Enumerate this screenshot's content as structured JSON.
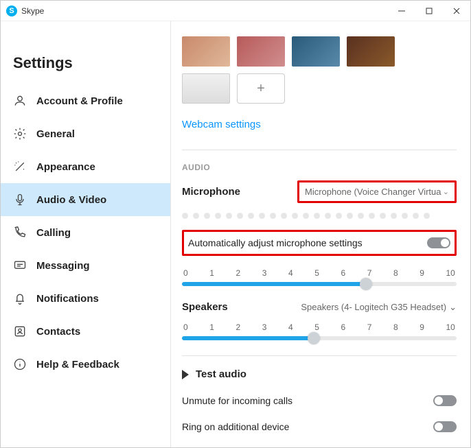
{
  "window": {
    "title": "Skype"
  },
  "sidebar": {
    "heading": "Settings",
    "items": [
      {
        "label": "Account & Profile"
      },
      {
        "label": "General"
      },
      {
        "label": "Appearance"
      },
      {
        "label": "Audio & Video"
      },
      {
        "label": "Calling"
      },
      {
        "label": "Messaging"
      },
      {
        "label": "Notifications"
      },
      {
        "label": "Contacts"
      },
      {
        "label": "Help & Feedback"
      }
    ]
  },
  "main": {
    "webcam_link": "Webcam settings",
    "audio_section": "AUDIO",
    "microphone_label": "Microphone",
    "microphone_value": "Microphone (Voice Changer Virtua",
    "auto_adjust_label": "Automatically adjust microphone settings",
    "mic_slider": {
      "value": 6.7,
      "min": 0,
      "max": 10
    },
    "speakers_label": "Speakers",
    "speakers_value": "Speakers (4- Logitech G35 Headset)",
    "speaker_slider": {
      "value": 4.8,
      "min": 0,
      "max": 10
    },
    "test_audio": "Test audio",
    "unmute_label": "Unmute for incoming calls",
    "ring_label": "Ring on additional device",
    "ticks": [
      "0",
      "1",
      "2",
      "3",
      "4",
      "5",
      "6",
      "7",
      "8",
      "9",
      "10"
    ]
  }
}
